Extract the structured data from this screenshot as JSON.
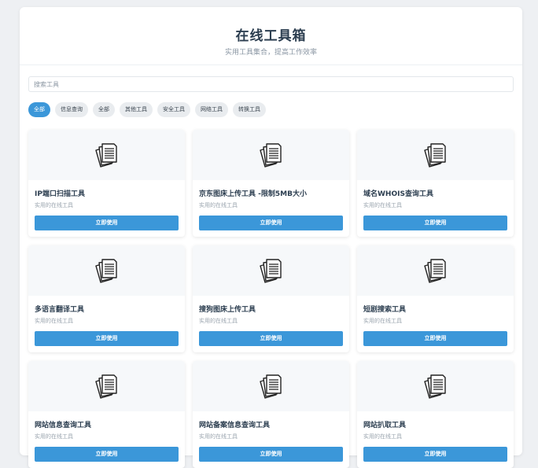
{
  "header": {
    "title": "在线工具箱",
    "subtitle": "实用工具集合，提高工作效率"
  },
  "search": {
    "placeholder": "搜索工具"
  },
  "categories": [
    {
      "label": "全部",
      "active": true
    },
    {
      "label": "信息查询",
      "active": false
    },
    {
      "label": "全部",
      "active": false
    },
    {
      "label": "其他工具",
      "active": false
    },
    {
      "label": "安全工具",
      "active": false
    },
    {
      "label": "网络工具",
      "active": false
    },
    {
      "label": "转换工具",
      "active": false
    }
  ],
  "tools": [
    {
      "title": "IP端口扫描工具",
      "desc": "实用的在线工具",
      "button": "立即使用",
      "icon": "document-stack-icon"
    },
    {
      "title": "京东图床上传工具 -限制5MB大小",
      "desc": "实用的在线工具",
      "button": "立即使用",
      "icon": "document-stack-icon"
    },
    {
      "title": "域名WHOIS查询工具",
      "desc": "实用的在线工具",
      "button": "立即使用",
      "icon": "document-stack-icon"
    },
    {
      "title": "多语言翻译工具",
      "desc": "实用的在线工具",
      "button": "立即使用",
      "icon": "document-stack-icon"
    },
    {
      "title": "搜狗图床上传工具",
      "desc": "实用的在线工具",
      "button": "立即使用",
      "icon": "document-stack-icon"
    },
    {
      "title": "短剧搜索工具",
      "desc": "实用的在线工具",
      "button": "立即使用",
      "icon": "document-stack-icon"
    },
    {
      "title": "网站信息查询工具",
      "desc": "实用的在线工具",
      "button": "立即使用",
      "icon": "document-stack-icon"
    },
    {
      "title": "网站备案信息查询工具",
      "desc": "实用的在线工具",
      "button": "立即使用",
      "icon": "document-stack-icon"
    },
    {
      "title": "网站扒取工具",
      "desc": "实用的在线工具",
      "button": "立即使用",
      "icon": "document-stack-icon"
    }
  ],
  "colors": {
    "accent": "#3b97d9",
    "text": "#2c3e50",
    "muted": "#9aa4ae",
    "background": "#eef0f3"
  }
}
